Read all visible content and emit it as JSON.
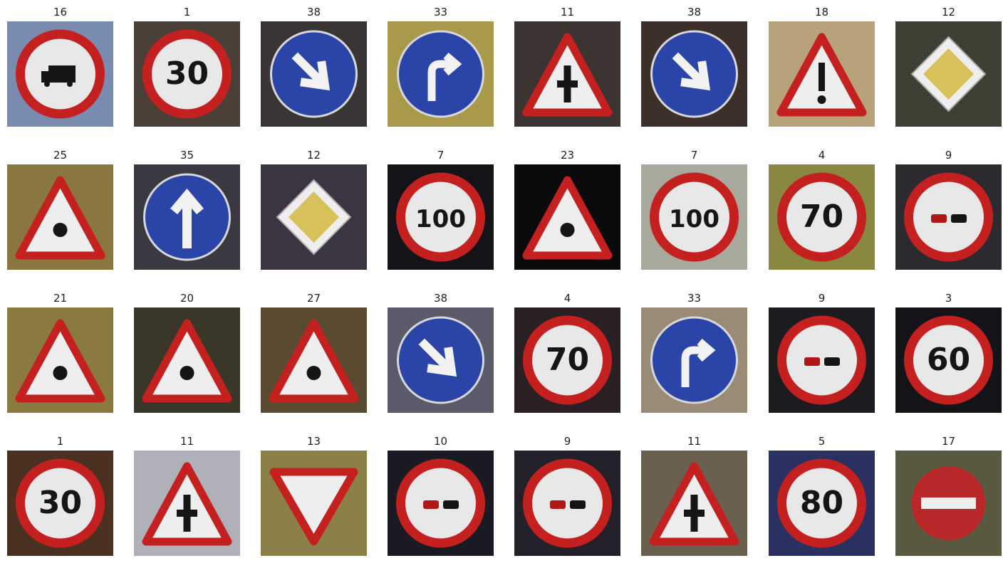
{
  "grid": {
    "tiles": [
      {
        "label": "16",
        "bg": "#7a8bb0",
        "sign": "circle-prohibit",
        "glyph": "truck"
      },
      {
        "label": "1",
        "bg": "#4a4038",
        "sign": "circle-prohibit",
        "glyph": "30"
      },
      {
        "label": "38",
        "bg": "#3a3535",
        "sign": "round-blue",
        "glyph": "arrow-se"
      },
      {
        "label": "33",
        "bg": "#a89a4a",
        "sign": "round-blue",
        "glyph": "turn-right"
      },
      {
        "label": "11",
        "bg": "#3b3431",
        "sign": "warning",
        "glyph": "crossroad"
      },
      {
        "label": "38",
        "bg": "#3d302a",
        "sign": "round-blue",
        "glyph": "arrow-se"
      },
      {
        "label": "18",
        "bg": "#b8a27a",
        "sign": "warning",
        "glyph": "exclaim"
      },
      {
        "label": "12",
        "bg": "#3c4134",
        "sign": "priority",
        "glyph": ""
      },
      {
        "label": "25",
        "bg": "#8a7640",
        "sign": "warning",
        "glyph": "roadwork"
      },
      {
        "label": "35",
        "bg": "#3a3840",
        "sign": "round-blue",
        "glyph": "arrow-up"
      },
      {
        "label": "12",
        "bg": "#3a3540",
        "sign": "priority",
        "glyph": ""
      },
      {
        "label": "7",
        "bg": "#141418",
        "sign": "circle-prohibit",
        "glyph": "100"
      },
      {
        "label": "23",
        "bg": "#0a0a0c",
        "sign": "warning",
        "glyph": "slippery"
      },
      {
        "label": "7",
        "bg": "#a8a89c",
        "sign": "circle-prohibit",
        "glyph": "100"
      },
      {
        "label": "4",
        "bg": "#8a8840",
        "sign": "circle-prohibit",
        "glyph": "70"
      },
      {
        "label": "9",
        "bg": "#2c2a2e",
        "sign": "circle-prohibit",
        "glyph": "overtake"
      },
      {
        "label": "21",
        "bg": "#8a7a40",
        "sign": "warning",
        "glyph": "double-curve"
      },
      {
        "label": "20",
        "bg": "#3a3628",
        "sign": "warning",
        "glyph": "curve-right"
      },
      {
        "label": "27",
        "bg": "#5a4a30",
        "sign": "warning",
        "glyph": "pedestrian"
      },
      {
        "label": "38",
        "bg": "#5a5a6a",
        "sign": "round-blue",
        "glyph": "arrow-se"
      },
      {
        "label": "4",
        "bg": "#2a2024",
        "sign": "circle-prohibit",
        "glyph": "70"
      },
      {
        "label": "33",
        "bg": "#9a8a78",
        "sign": "round-blue",
        "glyph": "turn-right"
      },
      {
        "label": "9",
        "bg": "#1c1c20",
        "sign": "circle-prohibit",
        "glyph": "overtake"
      },
      {
        "label": "3",
        "bg": "#141418",
        "sign": "circle-prohibit",
        "glyph": "60"
      },
      {
        "label": "1",
        "bg": "#4a3020",
        "sign": "circle-prohibit",
        "glyph": "30"
      },
      {
        "label": "11",
        "bg": "#b0b0b8",
        "sign": "warning",
        "glyph": "crossroad"
      },
      {
        "label": "13",
        "bg": "#8a8048",
        "sign": "yield",
        "glyph": ""
      },
      {
        "label": "10",
        "bg": "#1a1a22",
        "sign": "circle-prohibit",
        "glyph": "overtake-truck"
      },
      {
        "label": "9",
        "bg": "#24202a",
        "sign": "circle-prohibit",
        "glyph": "overtake"
      },
      {
        "label": "11",
        "bg": "#6a6050",
        "sign": "warning",
        "glyph": "crossroad"
      },
      {
        "label": "5",
        "bg": "#2a3060",
        "sign": "circle-prohibit",
        "glyph": "80"
      },
      {
        "label": "17",
        "bg": "#5a5a40",
        "sign": "no-entry",
        "glyph": ""
      }
    ]
  }
}
